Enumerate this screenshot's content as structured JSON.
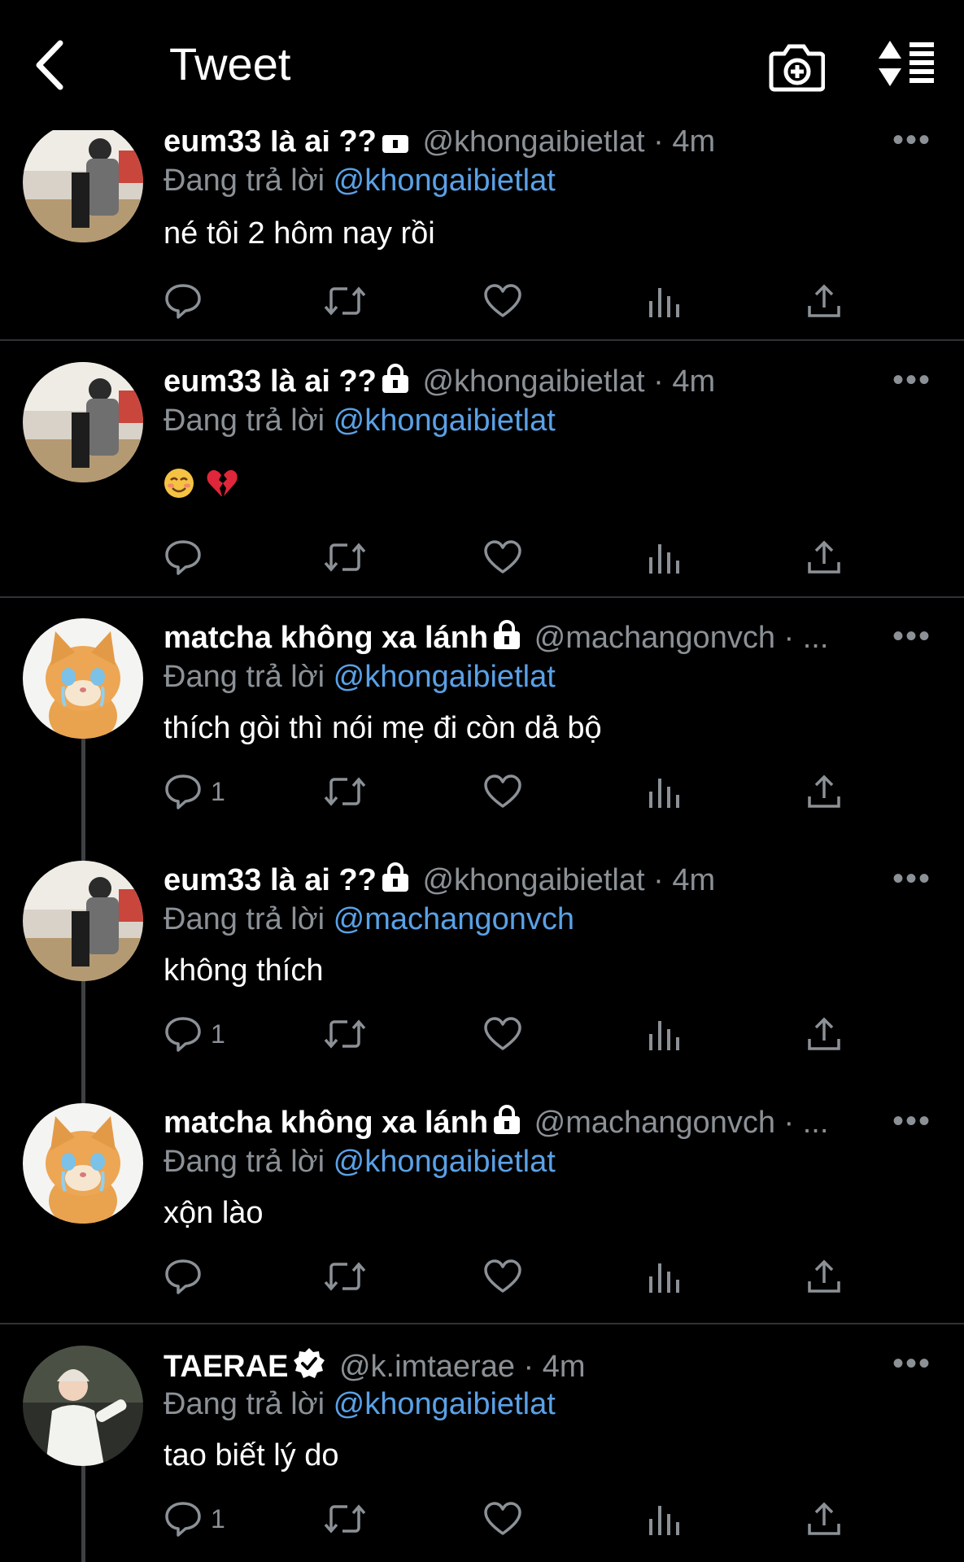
{
  "header": {
    "title": "Tweet",
    "back_icon": "chevron-left-icon",
    "camera_icon": "camera-add-icon",
    "sort_icon": "sort-list-icon"
  },
  "colors": {
    "background": "#000000",
    "text": "#ffffff",
    "secondary": "#8b9196",
    "link": "#5aa1e6",
    "divider": "#2f3336"
  },
  "reply_prefix": "Đang trả lời",
  "tweets": [
    {
      "name": "eum33 là ai ??",
      "lock": true,
      "verified": false,
      "handle": "@khongaibietlat",
      "time": "· 4m",
      "reply_to": "@khongaibietlat",
      "text": "né tôi 2 hôm nay rồi",
      "reply_count": "",
      "avatar": "person-photo"
    },
    {
      "name": "eum33 là ai ??",
      "lock": true,
      "verified": false,
      "handle": "@khongaibietlat",
      "time": "· 4m",
      "reply_to": "@khongaibietlat",
      "text": "",
      "emojis": [
        "smiling-face-emoji",
        "broken-heart-emoji"
      ],
      "reply_count": "",
      "avatar": "person-photo"
    },
    {
      "name": "matcha không xa lánh",
      "lock": true,
      "verified": false,
      "handle": "@machangonvch",
      "time": "· ...",
      "reply_to": "@khongaibietlat",
      "text": "thích gòi thì nói mẹ đi còn dả bộ",
      "reply_count": "1",
      "avatar": "crying-kitten-photo"
    },
    {
      "name": "eum33 là ai ??",
      "lock": true,
      "verified": false,
      "handle": "@khongaibietlat",
      "time": "· 4m",
      "reply_to": "@machangonvch",
      "text": "không thích",
      "reply_count": "1",
      "avatar": "person-photo"
    },
    {
      "name": "matcha không xa lánh",
      "lock": true,
      "verified": false,
      "handle": "@machangonvch",
      "time": "· ...",
      "reply_to": "@khongaibietlat",
      "text": "xộn lào",
      "reply_count": "",
      "avatar": "crying-kitten-photo"
    },
    {
      "name": "TAERAE",
      "lock": false,
      "verified": true,
      "handle": "@k.imtaerae",
      "time": "· 4m",
      "reply_to": "@khongaibietlat",
      "text": "tao biết lý do",
      "reply_count": "1",
      "avatar": "person-white-jacket-photo"
    }
  ]
}
